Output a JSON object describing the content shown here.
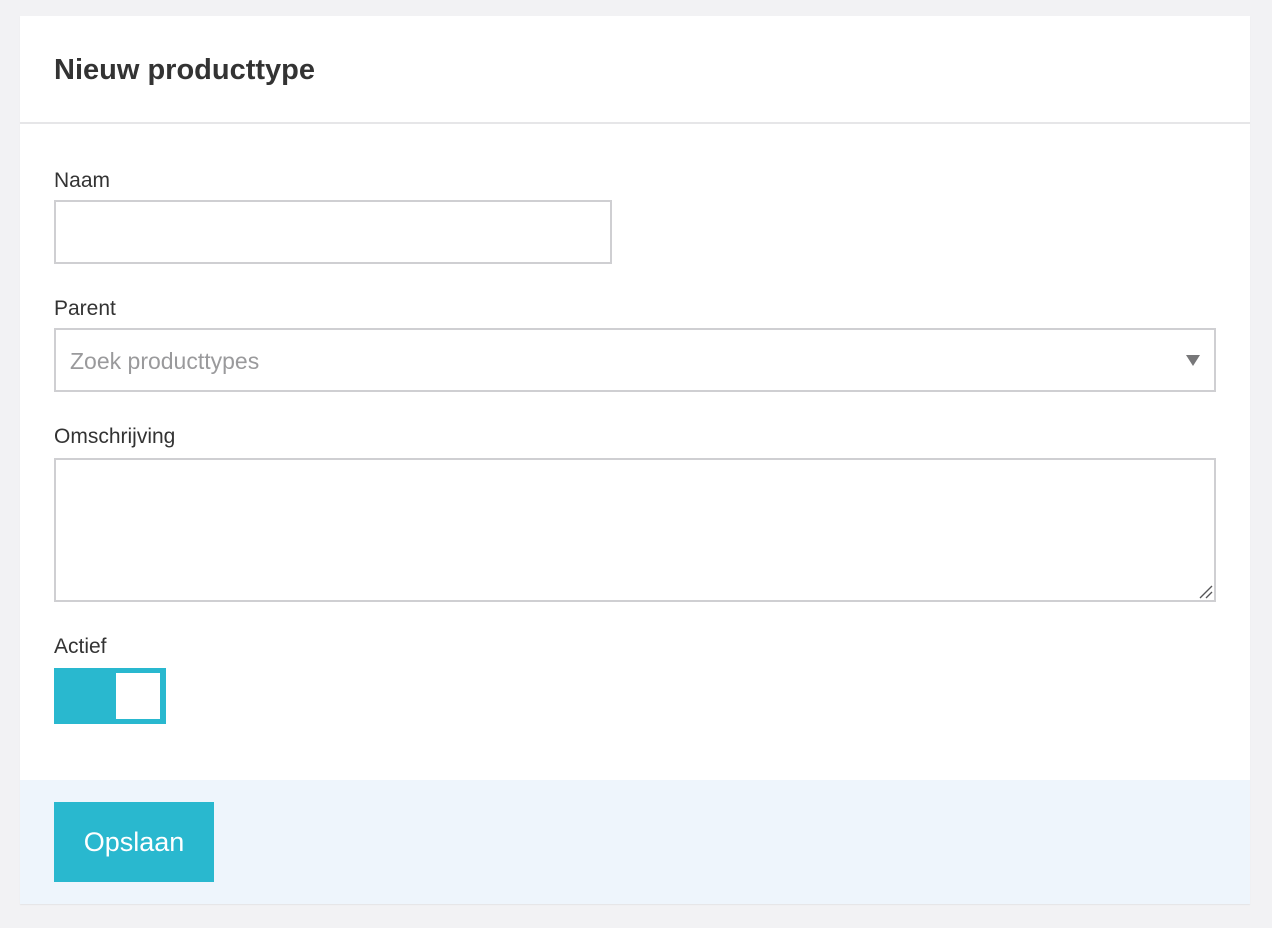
{
  "header": {
    "title": "Nieuw producttype"
  },
  "form": {
    "name": {
      "label": "Naam",
      "value": ""
    },
    "parent": {
      "label": "Parent",
      "placeholder": "Zoek producttypes"
    },
    "description": {
      "label": "Omschrijving",
      "value": ""
    },
    "active": {
      "label": "Actief",
      "checked": true
    }
  },
  "footer": {
    "save_label": "Opslaan"
  },
  "icons": {
    "select_arrow": "chevron-down-icon",
    "resize": "resize-handle-icon"
  },
  "colors": {
    "accent": "#29b8cf",
    "footer_background": "#eef5fc",
    "page_background": "#f2f2f4",
    "border": "#cfcfd2",
    "text": "#333333",
    "placeholder": "#9a9a9c"
  }
}
